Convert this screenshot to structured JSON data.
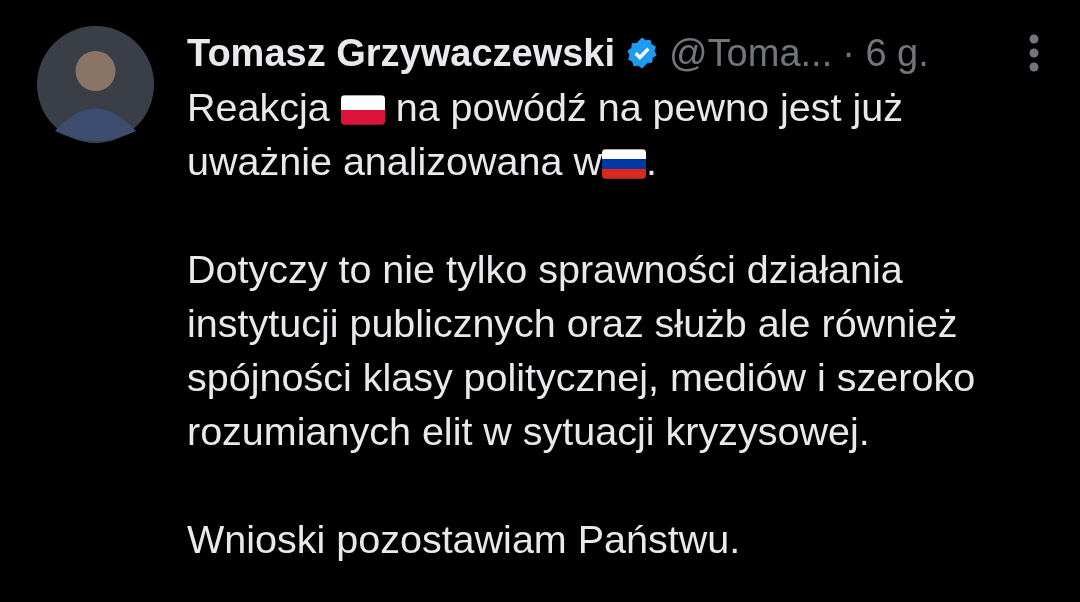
{
  "tweet": {
    "author": {
      "name": "Tomasz Grzywaczewski",
      "verified": true,
      "handle": "@Toma...",
      "time": "· 6 g."
    },
    "paragraphs": [
      {
        "segments": [
          {
            "kind": "text",
            "text": "Reakcja "
          },
          {
            "kind": "flag",
            "stripes": [
              {
                "color": "#ffffff"
              },
              {
                "color": "#dc143c"
              }
            ]
          },
          {
            "kind": "text",
            "text": " na powódź na pewno jest już uważnie analizowana w"
          },
          {
            "kind": "flag",
            "stripes": [
              {
                "color": "#ffffff"
              },
              {
                "color": "#0039a6"
              },
              {
                "color": "#d52b1e"
              }
            ]
          },
          {
            "kind": "text",
            "text": "."
          }
        ]
      },
      {
        "segments": [
          {
            "kind": "text",
            "text": "Dotyczy to nie tylko sprawności działania instytucji publicznych oraz służb ale również spójności klasy politycznej, mediów i szeroko rozumianych elit w sytuacji kryzysowej."
          }
        ]
      },
      {
        "segments": [
          {
            "kind": "text",
            "text": "Wnioski pozostawiam Państwu."
          }
        ]
      }
    ]
  }
}
